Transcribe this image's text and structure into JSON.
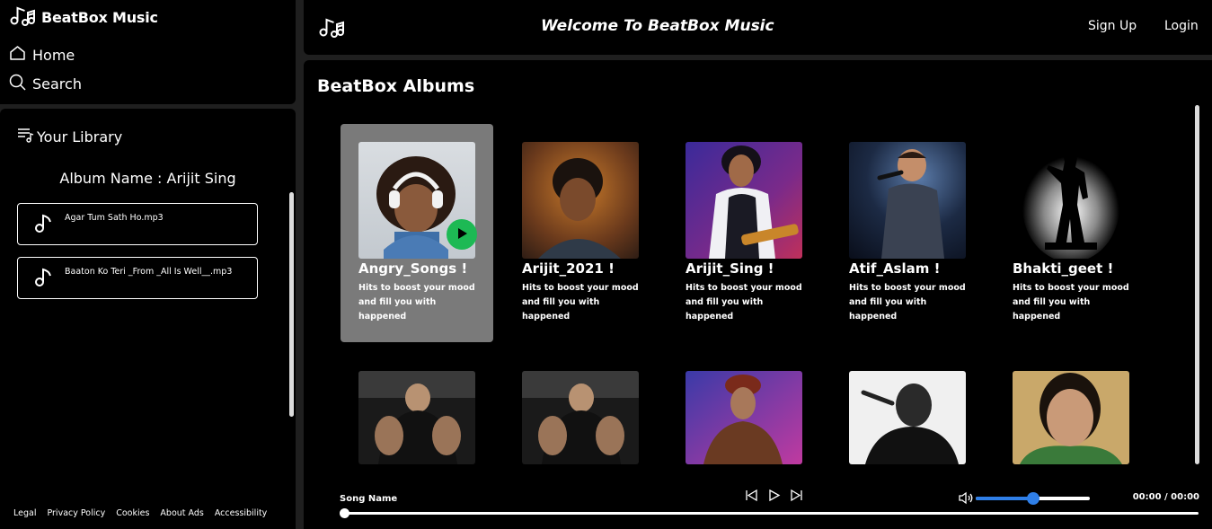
{
  "app": {
    "title": "BeatBox Music"
  },
  "nav": {
    "home": "Home",
    "search": "Search"
  },
  "library": {
    "heading": "Your Library",
    "album_label": "Album Name : Arijit Sing",
    "songs": [
      {
        "title": "Agar Tum Sath Ho.mp3"
      },
      {
        "title": "Baaton Ko Teri _From _All Is Well__.mp3"
      }
    ]
  },
  "footer": {
    "links": [
      "Legal",
      "Privacy Policy",
      "Cookies",
      "About Ads",
      "Accessibility"
    ]
  },
  "header": {
    "welcome": "Welcome To BeatBox Music",
    "signup": "Sign Up",
    "login": "Login"
  },
  "albums": {
    "heading": "BeatBox Albums",
    "items": [
      {
        "title": "Angry_Songs !",
        "description": "Hits to boost your mood and fill you with happened",
        "active": true
      },
      {
        "title": "Arijit_2021 !",
        "description": "Hits to boost your mood and fill you with happened"
      },
      {
        "title": "Arijit_Sing !",
        "description": "Hits to boost your mood and fill you with happened"
      },
      {
        "title": "Atif_Aslam !",
        "description": "Hits to boost your mood and fill you with happened"
      },
      {
        "title": "Bhakti_geet !",
        "description": "Hits to boost your mood and fill you with happened"
      }
    ],
    "second_row_count": 5
  },
  "player": {
    "song_name": "Song Name",
    "time": "00:00 / 00:00",
    "volume_level": 0.5,
    "progress": 0
  },
  "colors": {
    "accent_blue": "#2f7fe8",
    "play_green": "#1db954",
    "panel": "#000000",
    "active_card": "#7a7a7a"
  }
}
